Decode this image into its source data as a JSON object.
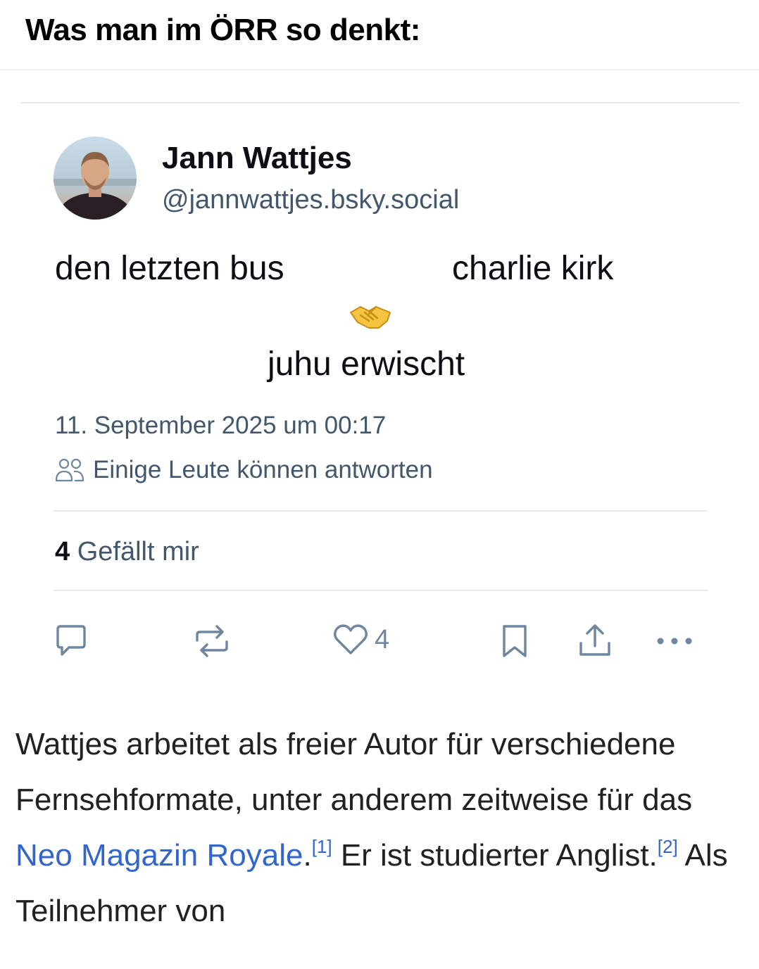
{
  "headline": "Was man im ÖRR so denkt:",
  "post": {
    "author_name": "Jann Wattjes",
    "author_handle": "@jannwattjes.bsky.social",
    "meme": {
      "left": "den letzten bus",
      "right": "charlie kirk",
      "emoji_icon": "handshake-icon",
      "bottom": "juhu erwischt"
    },
    "timestamp": "11. September 2025 um 00:17",
    "reply_setting": "Einige Leute können antworten",
    "likes_count": "4",
    "likes_label": "Gefällt mir",
    "actions": {
      "reply_icon": "comment-icon",
      "repost_icon": "repost-icon",
      "like_icon": "heart-icon",
      "like_count": "4",
      "bookmark_icon": "bookmark-icon",
      "share_icon": "share-icon",
      "more_icon": "more-icon"
    }
  },
  "wiki": {
    "text_1": "Wattjes arbeitet als freier Autor für verschiedene Fernsehformate, unter anderem zeitweise für das ",
    "link_1": "Neo Magazin Royale",
    "text_2": ".",
    "ref_1": "[1]",
    "text_3": " Er ist studierter Anglist.",
    "ref_2": "[2]",
    "text_4": " Als Teilnehmer von"
  },
  "colors": {
    "text_primary": "#0b0f14",
    "text_secondary": "#42576c",
    "icon": "#6f869f",
    "wiki_link": "#3366cc"
  }
}
